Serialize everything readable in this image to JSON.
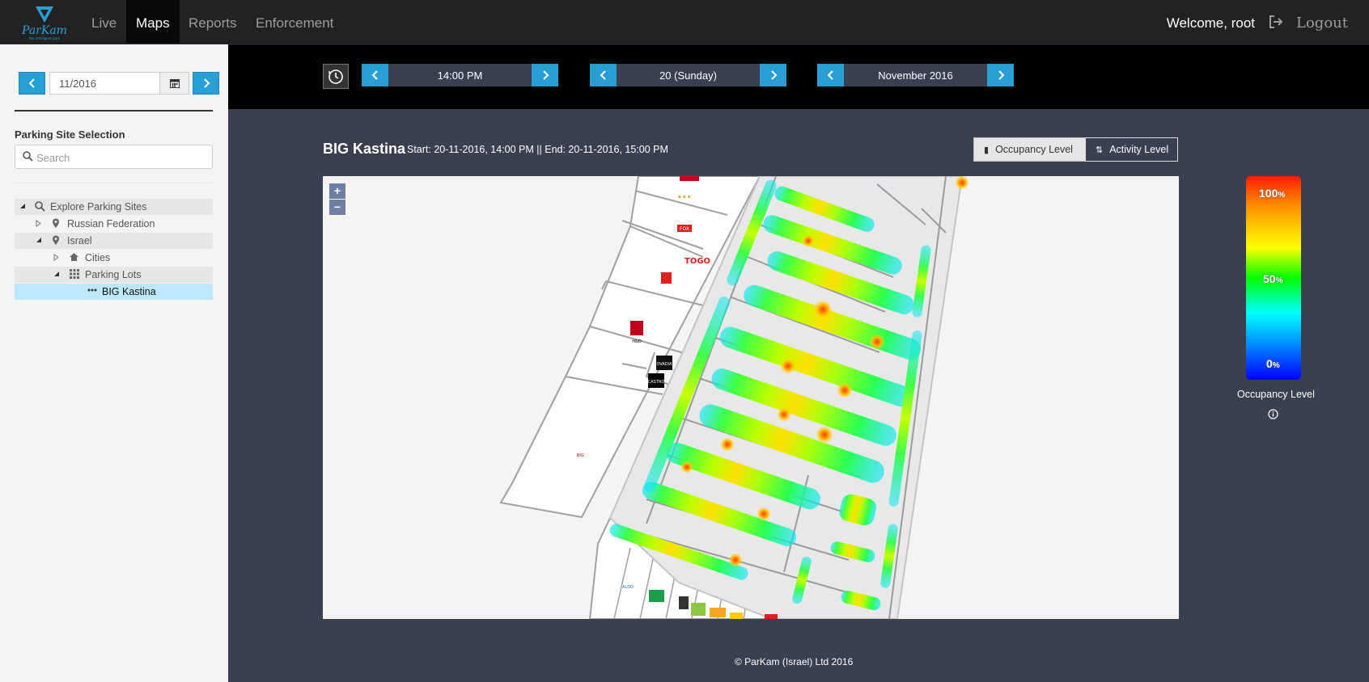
{
  "app": {
    "logo_text": "ParKam",
    "logo_tagline": "the intelligent park"
  },
  "nav": {
    "items": [
      {
        "label": "Live",
        "active": false
      },
      {
        "label": "Maps",
        "active": true
      },
      {
        "label": "Reports",
        "active": false
      },
      {
        "label": "Enforcement",
        "active": false
      }
    ],
    "welcome": "Welcome, root",
    "logout": "Logout"
  },
  "sidebar": {
    "date_value": "11/2016",
    "section_title": "Parking Site Selection",
    "search_placeholder": "Search",
    "tree": [
      {
        "label": "Explore Parking Sites",
        "icon": "search-icon",
        "expanded": true
      },
      {
        "label": "Russian Federation",
        "icon": "map-marker-icon",
        "expanded": false
      },
      {
        "label": "Israel",
        "icon": "map-marker-icon",
        "expanded": true
      },
      {
        "label": "Cities",
        "icon": "home-icon",
        "expanded": false
      },
      {
        "label": "Parking Lots",
        "icon": "grid-icon",
        "expanded": true
      },
      {
        "label": "BIG Kastina",
        "icon": "ellipsis-icon",
        "selected": true
      }
    ]
  },
  "controls": {
    "time": "14:00 PM",
    "day": "20 (Sunday)",
    "month": "November 2016"
  },
  "site": {
    "title": "BIG Kastina",
    "range": "Start: 20-11-2016, 14:00 PM ||  End: 20-11-2016, 15:00 PM"
  },
  "toggle": {
    "occupancy": "Occupancy Level",
    "activity": "Activity Level",
    "active": "occupancy"
  },
  "map": {
    "zoom_in": "+",
    "zoom_out": "−",
    "store_labels": [
      "FOX",
      "TOGO",
      "H&O",
      "OVADIA",
      "CASTRO",
      "BIG",
      "ALDO"
    ]
  },
  "legend": {
    "max": "100",
    "mid": "50",
    "min": "0",
    "unit": "%",
    "title": "Occupancy Level"
  },
  "colors": {
    "accent": "#2a9fd6",
    "navbar": "#222222",
    "content_bg": "#3a4050",
    "selected_row": "#bde7fa"
  },
  "footer": "© ParKam (Israel) Ltd 2016"
}
